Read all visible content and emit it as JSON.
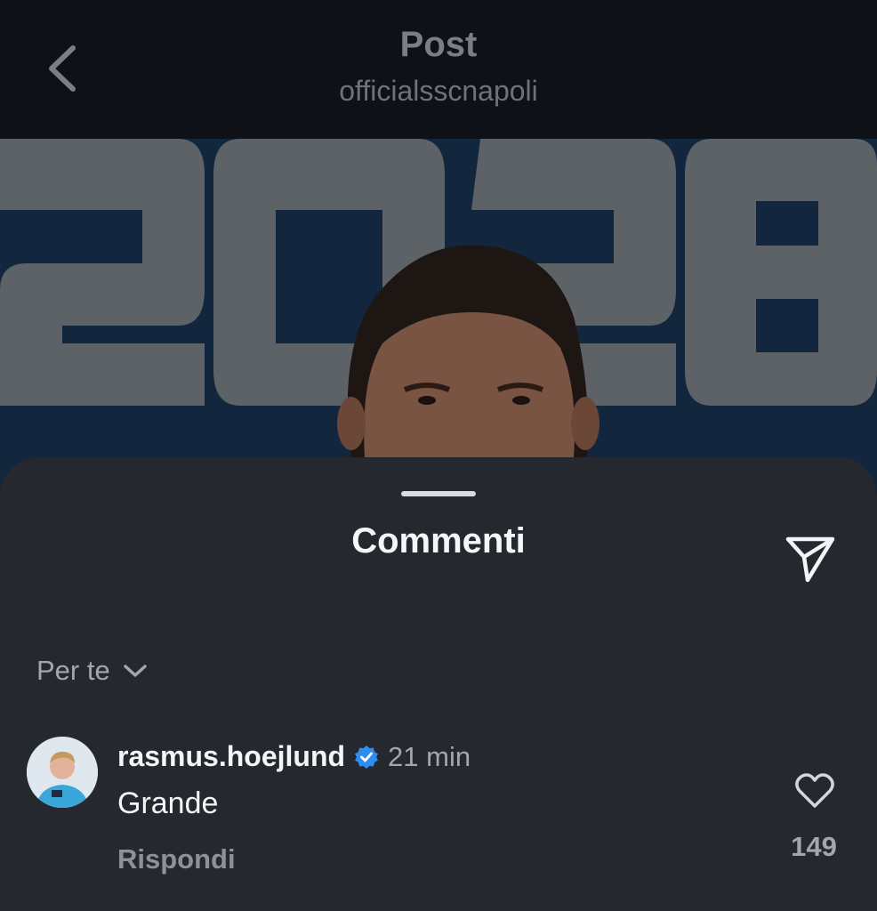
{
  "header": {
    "title": "Post",
    "subtitle": "officialsscnapoli",
    "back_icon": "chevron-left-icon"
  },
  "post_image": {
    "description_text": "2028",
    "colors": {
      "background": "#12263d",
      "digits": "#5c6266"
    }
  },
  "comments_sheet": {
    "title": "Commenti",
    "share_icon": "send-icon",
    "sort": {
      "label": "Per te",
      "icon": "chevron-down-icon"
    },
    "comments": [
      {
        "username": "rasmus.hoejlund",
        "verified": true,
        "time": "21 min",
        "text": "Grande",
        "reply_label": "Rispondi",
        "likes": "149",
        "like_icon": "heart-icon"
      }
    ]
  },
  "colors": {
    "sheet_bg": "#25282e",
    "verified_badge": "#2f8cf0",
    "muted_text": "#a3a7ad"
  }
}
